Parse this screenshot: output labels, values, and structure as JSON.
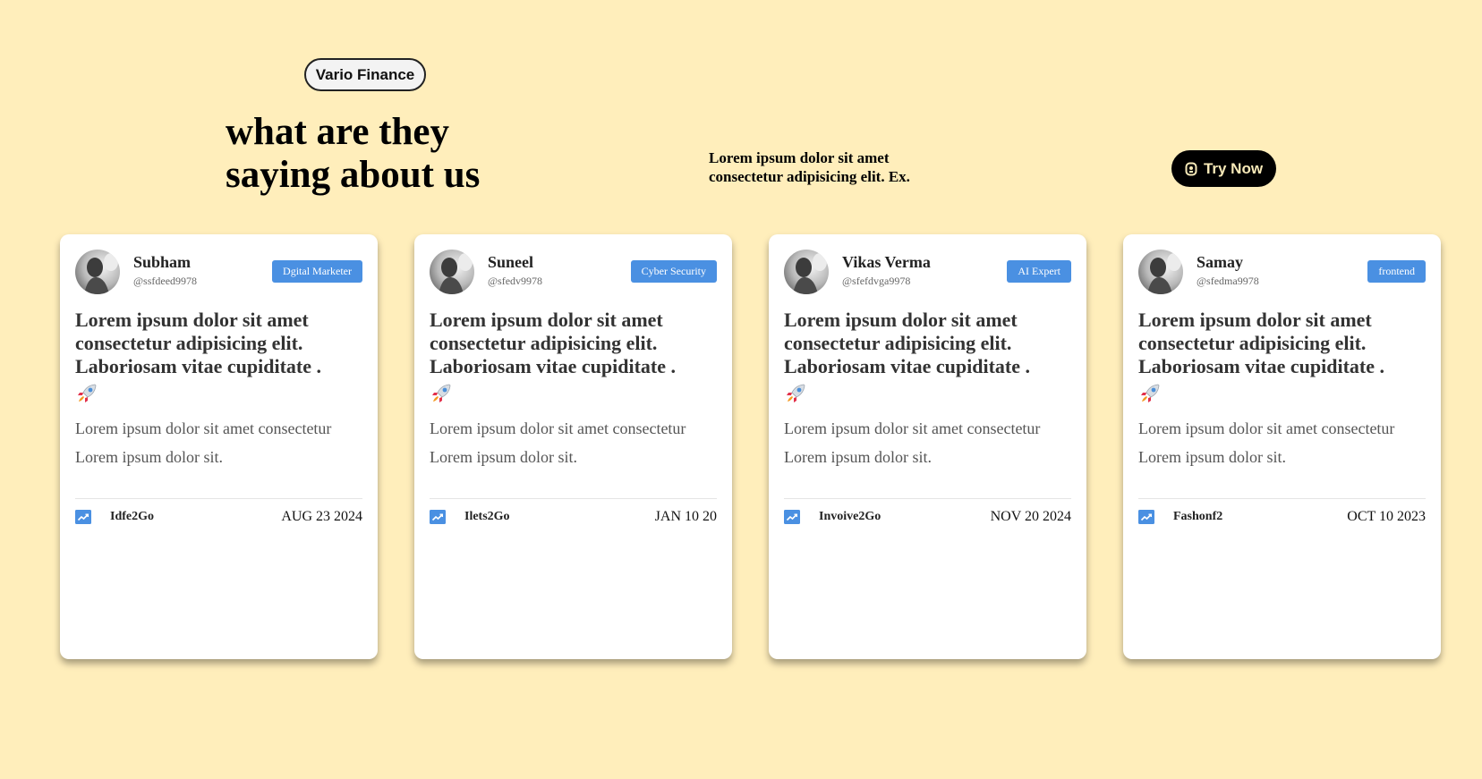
{
  "brand_pill": "Vario Finance",
  "headline": "what are they saying about us",
  "subtitle": "Lorem ipsum dolor sit amet consectetur adipisicing elit. Ex.",
  "cta": {
    "label": "Try Now",
    "icon": "gear-badge-icon"
  },
  "colors": {
    "background": "#ffeebb",
    "tag": "#4a90e2",
    "cta_bg": "#000000",
    "cta_text": "#f7e9b8"
  },
  "cards": [
    {
      "name": "Subham",
      "handle": "@ssfdeed9978",
      "tag": "Dgital Marketer",
      "title": "Lorem ipsum dolor sit amet consectetur adipisicing elit. Laboriosam vitae cupiditate .",
      "emoji_icon": "rocket-icon",
      "body": "Lorem ipsum dolor sit amet consectetur Lorem ipsum dolor sit.",
      "app": "Idfe2Go",
      "date": "AUG 23 2024"
    },
    {
      "name": "Suneel",
      "handle": "@sfedv9978",
      "tag": "Cyber Security",
      "title": "Lorem ipsum dolor sit amet consectetur adipisicing elit. Laboriosam vitae cupiditate .",
      "emoji_icon": "rocket-icon",
      "body": "Lorem ipsum dolor sit amet consectetur Lorem ipsum dolor sit.",
      "app": "Ilets2Go",
      "date": "JAN 10 20"
    },
    {
      "name": "Vikas Verma",
      "handle": "@sfefdvga9978",
      "tag": "AI Expert",
      "title": "Lorem ipsum dolor sit amet consectetur adipisicing elit. Laboriosam vitae cupiditate .",
      "emoji_icon": "rocket-icon",
      "body": "Lorem ipsum dolor sit amet consectetur Lorem ipsum dolor sit.",
      "app": "Invoive2Go",
      "date": "NOV 20 2024"
    },
    {
      "name": "Samay",
      "handle": "@sfedma9978",
      "tag": "frontend",
      "title": "Lorem ipsum dolor sit amet consectetur adipisicing elit. Laboriosam vitae cupiditate .",
      "emoji_icon": "rocket-icon",
      "body": "Lorem ipsum dolor sit amet consectetur Lorem ipsum dolor sit.",
      "app": "Fashonf2",
      "date": "OCT 10 2023"
    }
  ]
}
